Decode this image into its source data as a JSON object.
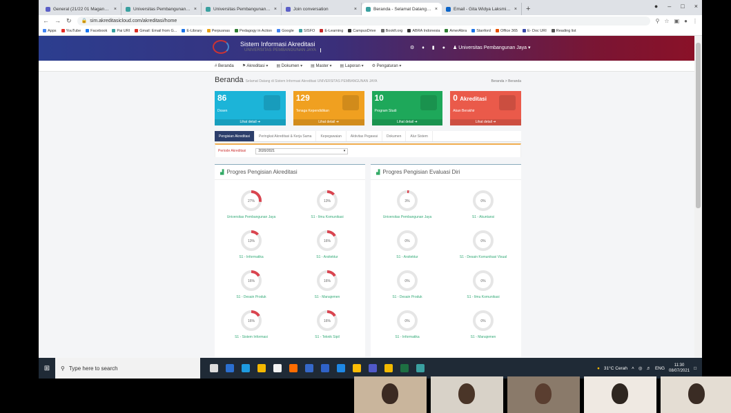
{
  "browser": {
    "tabs": [
      {
        "title": "General (21/22 01 Magang @ U",
        "color": "#5b5fc7"
      },
      {
        "title": "Universitas Pembangunan Jaya",
        "color": "#3aa0a0"
      },
      {
        "title": "Universitas Pembangunan Jaya",
        "color": "#3aa0a0"
      },
      {
        "title": "Join conversation",
        "color": "#5b5fc7"
      },
      {
        "title": "Beranda - Selamat Datang di Sist",
        "color": "#3aa0a0",
        "active": true
      },
      {
        "title": "Email - Gita Widya Laksmini Soed",
        "color": "#0a64c8"
      }
    ],
    "new_tab": "+",
    "url": "sim.akreditasicloud.com/akreditasi/home",
    "bookmarks": [
      {
        "label": "Apps",
        "color": "#4285f4"
      },
      {
        "label": "YouTube",
        "color": "#e52d27"
      },
      {
        "label": "Facebook",
        "color": "#1877f2"
      },
      {
        "label": "Pai URI",
        "color": "#3aa0a0"
      },
      {
        "label": "Gmail: Email from G...",
        "color": "#d93025"
      },
      {
        "label": "E-Library",
        "color": "#1a73e8"
      },
      {
        "label": "Perpusnas",
        "color": "#e8a317"
      },
      {
        "label": "Pedagogy in Action",
        "color": "#2e7d32"
      },
      {
        "label": "Google",
        "color": "#4285f4"
      },
      {
        "label": "SISFO",
        "color": "#3aa0a0"
      },
      {
        "label": "E-Learning",
        "color": "#c62828"
      },
      {
        "label": "CampusDrive",
        "color": "#333333"
      },
      {
        "label": "Bookfi.org",
        "color": "#6a6a6a"
      },
      {
        "label": "ABRA Indonesia",
        "color": "#333333"
      },
      {
        "label": "AmerAbra",
        "color": "#2e7d32"
      },
      {
        "label": "Stanford",
        "color": "#1a73e8"
      },
      {
        "label": "Office 365",
        "color": "#e65100"
      },
      {
        "label": "E- Doc URI",
        "color": "#3949ab"
      },
      {
        "label": "Reading list",
        "color": "#555555"
      }
    ]
  },
  "site": {
    "title": "Sistem Informasi Akreditasi",
    "subtitle": "UNIVERSITAS PEMBANGUNAN JAYA",
    "user": "Universitas Pembangunan Jaya",
    "menu": [
      "Beranda",
      "Akreditasi",
      "Dokumen",
      "Master",
      "Laporan",
      "Pengaturan"
    ]
  },
  "page": {
    "heading": "Beranda",
    "subheading": "Selamat Datang di Sistem Informasi Akreditasi UNIVERSITAS PEMBANGUNAN JAYA",
    "breadcrumb": "Beranda  >  Beranda"
  },
  "stats": [
    {
      "value": "86",
      "label": "Dosen",
      "more": "Lihat detail",
      "color": "#1cb4d8"
    },
    {
      "value": "129",
      "label": "Tenaga Kependidikan",
      "more": "Lihat detail",
      "color": "#f0a020"
    },
    {
      "value": "10",
      "label": "Program Studi",
      "more": "Lihat detail",
      "color": "#1ea85a"
    },
    {
      "value": "0",
      "value_suffix": "Akreditasi",
      "label": "Akan Berakhir",
      "more": "Lihat detail",
      "color": "#ea5a4a"
    }
  ],
  "section_tabs": [
    "Pengisian Akreditasi",
    "Peringkat Akreditasi & Kerja Sama",
    "Kepegawaian",
    "Aktivitas Pegawai",
    "Dokumen",
    "Alur Sistem"
  ],
  "filter": {
    "label": "Periode Akreditasi",
    "value": "2020/2021"
  },
  "panels": [
    {
      "title": "Progres Pengisian Akreditasi",
      "gauges": [
        {
          "pct": 27,
          "label": "Universitas Pembangunan Jaya"
        },
        {
          "pct": 13,
          "label": "S1 - Ilmu Komunikasi"
        },
        {
          "pct": 13,
          "label": "S1 - Informatika"
        },
        {
          "pct": 16,
          "label": "S1 - Arsitektur"
        },
        {
          "pct": 16,
          "label": "S1 - Desain Produk"
        },
        {
          "pct": 16,
          "label": "S1 - Manajemen"
        },
        {
          "pct": 16,
          "label": "S1 - Sistem Informasi"
        },
        {
          "pct": 16,
          "label": "S1 - Teknik Sipil"
        }
      ]
    },
    {
      "title": "Progres Pengisian Evaluasi Diri",
      "gauges": [
        {
          "pct": 3,
          "label": "Universitas Pembangunan Jaya"
        },
        {
          "pct": 0,
          "label": "S1 - Akuntansi"
        },
        {
          "pct": 0,
          "label": "S1 - Arsitektur"
        },
        {
          "pct": 0,
          "label": "S1 - Desain Komunikasi Visual"
        },
        {
          "pct": 0,
          "label": "S1 - Desain Produk"
        },
        {
          "pct": 0,
          "label": "S1 - Ilmu Komunikasi"
        },
        {
          "pct": 0,
          "label": "S1 - Informatika"
        },
        {
          "pct": 0,
          "label": "S1 - Manajemen"
        }
      ]
    }
  ],
  "taskbar": {
    "search_placeholder": "Type here to search",
    "weather": "31°C Cerah",
    "lang": "ENG",
    "time": "11:30",
    "date": "08/07/2021"
  }
}
